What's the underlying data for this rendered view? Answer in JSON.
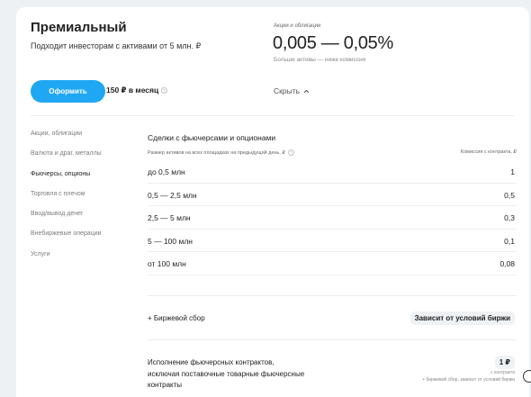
{
  "plan": {
    "title": "Премиальный",
    "description": "Подходит инвесторам с активами от 5 млн. ₽",
    "subscribe_label": "Оформить",
    "price": "150 ₽ в месяц",
    "collapse_label": "Скрыть",
    "collapse_icon": "chevron-up-icon",
    "info_icon": "info-icon"
  },
  "rate": {
    "label": "Акции и облигации",
    "value": "0,005 — 0,05%",
    "note": "Больше активы — ниже комиссия"
  },
  "sidebar": {
    "items": [
      {
        "label": "Акции, облигации",
        "active": false
      },
      {
        "label": "Валюта и драг. металлы",
        "active": false
      },
      {
        "label": "Фьючерсы, опционы",
        "active": true
      },
      {
        "label": "Торговля с плечом",
        "active": false
      },
      {
        "label": "Ввод/вывод денег",
        "active": false
      },
      {
        "label": "Внебиржевые операции",
        "active": false
      },
      {
        "label": "Услуги",
        "active": false
      }
    ]
  },
  "table": {
    "title": "Сделки с фьючерсами и опционами",
    "col_left": "Размер активов на всех площадках на предыдущий день, ₽",
    "col_right": "Комиссия с контракта, ₽",
    "rows": [
      {
        "range": "до 0,5 млн",
        "fee": "1"
      },
      {
        "range": "0,5 — 2,5 млн",
        "fee": "0,5"
      },
      {
        "range": "2,5 — 5 млн",
        "fee": "0,3"
      },
      {
        "range": "5 — 100 млн",
        "fee": "0,1"
      },
      {
        "range": "от 100 млн",
        "fee": "0,08"
      }
    ]
  },
  "exchange_fee": {
    "label": "+ Биржевой сбор",
    "value": "Зависит от условий биржи"
  },
  "execution": {
    "label": "Исполнение фьючерсных контрактов, исключая поставочные товарные фьючерсные контракты",
    "value": "1 ₽",
    "note1": "с контракта",
    "note2": "+ биржевой сбор, зависит от условий биржи"
  },
  "colors": {
    "accent": "#1fa7f3",
    "badge_bg": "#eef2f5",
    "page_bg": "#eef1f4"
  }
}
